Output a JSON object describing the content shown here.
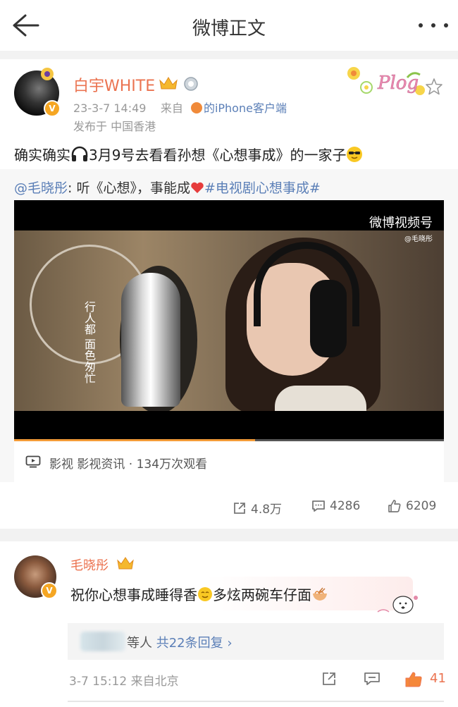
{
  "header": {
    "title": "微博正文"
  },
  "post": {
    "author": "白宇WHITE",
    "time": "23-3-7 14:49",
    "from_prefix": "来自",
    "source": "的iPhone客户端",
    "location": "发布于 中国香港",
    "sticker_text": "Plog",
    "text_before": "确实确实",
    "text_after": "3月9号去看看孙想《心想事成》的一家子",
    "repost": {
      "mention": "@毛晓彤",
      "text": ": 听《心想》，事能成",
      "hashtag": "#电视剧心想事成#"
    },
    "video": {
      "watermark": "微博视频号",
      "watermark_sub": "@毛晓彤",
      "lyrics": "行人都 面色匆忙",
      "progress": 0.56,
      "info": "影视 影视资讯 · 134万次观看"
    },
    "actions": {
      "reposts": "4.8万",
      "comments": "4286",
      "likes": "6209"
    }
  },
  "comment": {
    "author": "毛晓彤",
    "text_1": "祝你心想事成睡得香",
    "text_2": "多炫两碗车仔面",
    "reply_prefix": "等人",
    "reply_link": "共22条回复",
    "time": "3-7 15:12 来自北京",
    "likes": "41"
  },
  "colors": {
    "accent_orange": "#eb7350",
    "link_blue": "#5b7fb7",
    "progress": "#f29b38"
  }
}
